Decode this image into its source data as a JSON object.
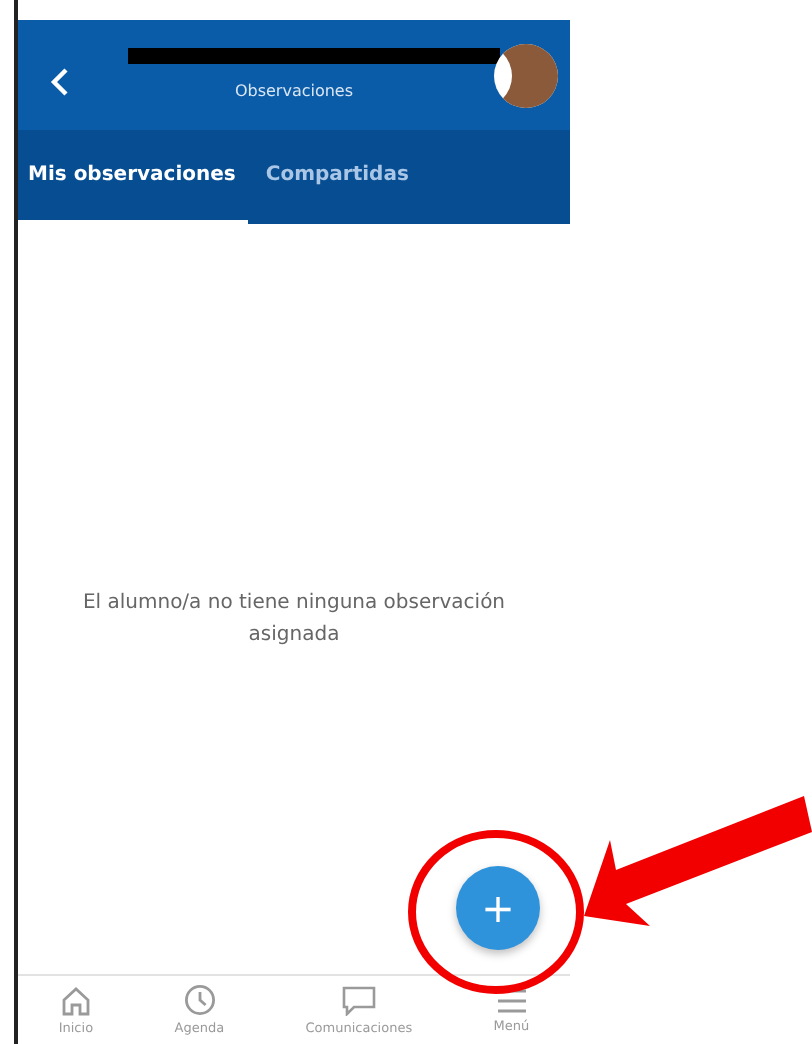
{
  "header": {
    "subtitle": "Observaciones"
  },
  "tabs": [
    {
      "label": "Mis observaciones",
      "selected": true
    },
    {
      "label": "Compartidas",
      "selected": false
    }
  ],
  "empty_message": "El alumno/a no tiene ninguna observación asignada",
  "fab": {
    "label": "+"
  },
  "bottom_nav": [
    {
      "label": "Inicio",
      "kind": "home"
    },
    {
      "label": "Agenda",
      "kind": "agenda"
    },
    {
      "label": "Comunicaciones",
      "kind": "messages"
    },
    {
      "label": "Menú",
      "kind": "menu"
    }
  ]
}
